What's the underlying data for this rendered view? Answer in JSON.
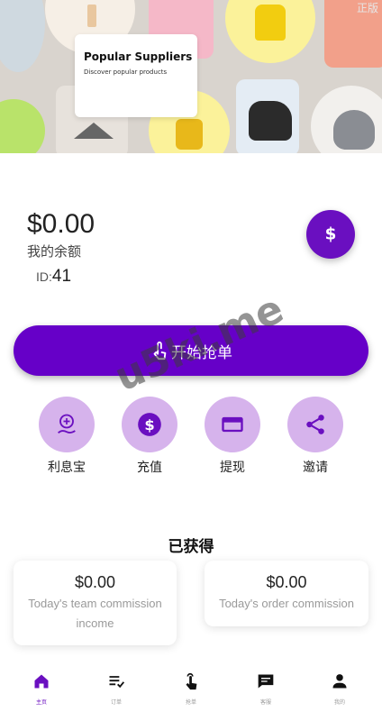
{
  "banner": {
    "title": "Popular Suppliers",
    "subtitle": "Discover popular products",
    "corner_text": "正版"
  },
  "account": {
    "balance": "$0.00",
    "balance_label": "我的余额",
    "id_label": "ID:",
    "id_value": "41"
  },
  "grab_button": {
    "label": "开始抢单",
    "icon": "tap-icon"
  },
  "actions": [
    {
      "label": "利息宝",
      "icon": "savings-icon"
    },
    {
      "label": "充值",
      "icon": "dollar-icon"
    },
    {
      "label": "提现",
      "icon": "card-icon"
    },
    {
      "label": "邀请",
      "icon": "share-icon"
    }
  ],
  "earned": {
    "title": "已获得",
    "cards": [
      {
        "amount": "$0.00",
        "label": "Today's team commission income"
      },
      {
        "amount": "$0.00",
        "label": "Today's order commission"
      }
    ]
  },
  "tabbar": [
    {
      "label": "主页",
      "icon": "home-icon",
      "active": true
    },
    {
      "label": "订单",
      "icon": "orders-icon",
      "active": false
    },
    {
      "label": "抢单",
      "icon": "tap-icon",
      "active": false
    },
    {
      "label": "客服",
      "icon": "chat-icon",
      "active": false
    },
    {
      "label": "我的",
      "icon": "person-icon",
      "active": false
    }
  ],
  "watermark": "u5ki.me",
  "colors": {
    "accent": "#6600c8",
    "action_circle": "#d6b3ec"
  }
}
